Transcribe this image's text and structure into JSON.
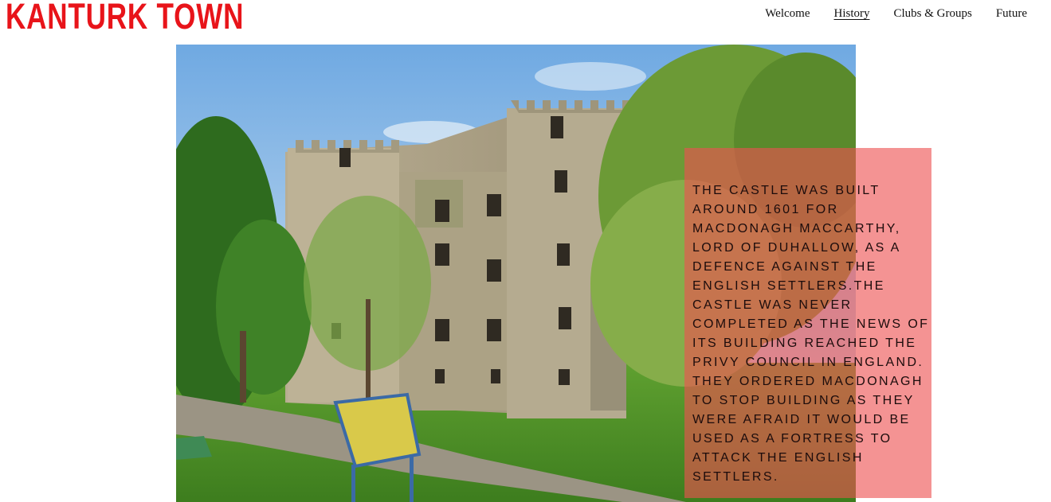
{
  "site": {
    "title": "KANTURK TOWN"
  },
  "nav": {
    "items": [
      {
        "label": "Welcome",
        "active": false
      },
      {
        "label": "History",
        "active": true
      },
      {
        "label": "Clubs & Groups",
        "active": false
      },
      {
        "label": "Future",
        "active": false
      }
    ]
  },
  "hero": {
    "image_subject": "castle-photo",
    "caption": "THE CASTLE WAS BUILT AROUND 1601 FOR MACDONAGH MACCARTHY, LORD OF DUHALLOW, AS A DEFENCE AGAINST THE ENGLISH SETTLERS.THE CASTLE WAS NEVER COMPLETED AS THE NEWS OF ITS BUILDING REACHED THE PRIVY COUNCIL IN ENGLAND. THEY ORDERED MACDONAGH TO STOP BUILDING AS THEY WERE AFRAID IT WOULD BE USED AS A FORTRESS TO ATTACK THE ENGLISH SETTLERS."
  },
  "colors": {
    "brand": "#e8141a",
    "caption_bg": "#ee5050"
  }
}
